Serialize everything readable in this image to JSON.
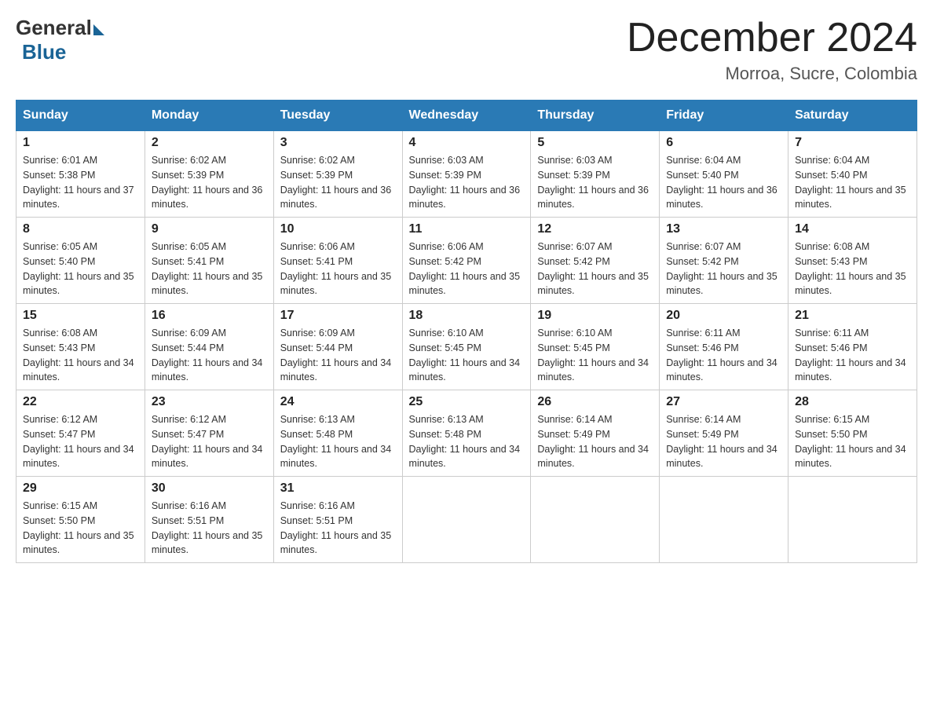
{
  "logo": {
    "general": "General",
    "blue": "Blue"
  },
  "header": {
    "month": "December 2024",
    "location": "Morroa, Sucre, Colombia"
  },
  "weekdays": [
    "Sunday",
    "Monday",
    "Tuesday",
    "Wednesday",
    "Thursday",
    "Friday",
    "Saturday"
  ],
  "weeks": [
    [
      {
        "day": "1",
        "sunrise": "6:01 AM",
        "sunset": "5:38 PM",
        "daylight": "11 hours and 37 minutes."
      },
      {
        "day": "2",
        "sunrise": "6:02 AM",
        "sunset": "5:39 PM",
        "daylight": "11 hours and 36 minutes."
      },
      {
        "day": "3",
        "sunrise": "6:02 AM",
        "sunset": "5:39 PM",
        "daylight": "11 hours and 36 minutes."
      },
      {
        "day": "4",
        "sunrise": "6:03 AM",
        "sunset": "5:39 PM",
        "daylight": "11 hours and 36 minutes."
      },
      {
        "day": "5",
        "sunrise": "6:03 AM",
        "sunset": "5:39 PM",
        "daylight": "11 hours and 36 minutes."
      },
      {
        "day": "6",
        "sunrise": "6:04 AM",
        "sunset": "5:40 PM",
        "daylight": "11 hours and 36 minutes."
      },
      {
        "day": "7",
        "sunrise": "6:04 AM",
        "sunset": "5:40 PM",
        "daylight": "11 hours and 35 minutes."
      }
    ],
    [
      {
        "day": "8",
        "sunrise": "6:05 AM",
        "sunset": "5:40 PM",
        "daylight": "11 hours and 35 minutes."
      },
      {
        "day": "9",
        "sunrise": "6:05 AM",
        "sunset": "5:41 PM",
        "daylight": "11 hours and 35 minutes."
      },
      {
        "day": "10",
        "sunrise": "6:06 AM",
        "sunset": "5:41 PM",
        "daylight": "11 hours and 35 minutes."
      },
      {
        "day": "11",
        "sunrise": "6:06 AM",
        "sunset": "5:42 PM",
        "daylight": "11 hours and 35 minutes."
      },
      {
        "day": "12",
        "sunrise": "6:07 AM",
        "sunset": "5:42 PM",
        "daylight": "11 hours and 35 minutes."
      },
      {
        "day": "13",
        "sunrise": "6:07 AM",
        "sunset": "5:42 PM",
        "daylight": "11 hours and 35 minutes."
      },
      {
        "day": "14",
        "sunrise": "6:08 AM",
        "sunset": "5:43 PM",
        "daylight": "11 hours and 35 minutes."
      }
    ],
    [
      {
        "day": "15",
        "sunrise": "6:08 AM",
        "sunset": "5:43 PM",
        "daylight": "11 hours and 34 minutes."
      },
      {
        "day": "16",
        "sunrise": "6:09 AM",
        "sunset": "5:44 PM",
        "daylight": "11 hours and 34 minutes."
      },
      {
        "day": "17",
        "sunrise": "6:09 AM",
        "sunset": "5:44 PM",
        "daylight": "11 hours and 34 minutes."
      },
      {
        "day": "18",
        "sunrise": "6:10 AM",
        "sunset": "5:45 PM",
        "daylight": "11 hours and 34 minutes."
      },
      {
        "day": "19",
        "sunrise": "6:10 AM",
        "sunset": "5:45 PM",
        "daylight": "11 hours and 34 minutes."
      },
      {
        "day": "20",
        "sunrise": "6:11 AM",
        "sunset": "5:46 PM",
        "daylight": "11 hours and 34 minutes."
      },
      {
        "day": "21",
        "sunrise": "6:11 AM",
        "sunset": "5:46 PM",
        "daylight": "11 hours and 34 minutes."
      }
    ],
    [
      {
        "day": "22",
        "sunrise": "6:12 AM",
        "sunset": "5:47 PM",
        "daylight": "11 hours and 34 minutes."
      },
      {
        "day": "23",
        "sunrise": "6:12 AM",
        "sunset": "5:47 PM",
        "daylight": "11 hours and 34 minutes."
      },
      {
        "day": "24",
        "sunrise": "6:13 AM",
        "sunset": "5:48 PM",
        "daylight": "11 hours and 34 minutes."
      },
      {
        "day": "25",
        "sunrise": "6:13 AM",
        "sunset": "5:48 PM",
        "daylight": "11 hours and 34 minutes."
      },
      {
        "day": "26",
        "sunrise": "6:14 AM",
        "sunset": "5:49 PM",
        "daylight": "11 hours and 34 minutes."
      },
      {
        "day": "27",
        "sunrise": "6:14 AM",
        "sunset": "5:49 PM",
        "daylight": "11 hours and 34 minutes."
      },
      {
        "day": "28",
        "sunrise": "6:15 AM",
        "sunset": "5:50 PM",
        "daylight": "11 hours and 34 minutes."
      }
    ],
    [
      {
        "day": "29",
        "sunrise": "6:15 AM",
        "sunset": "5:50 PM",
        "daylight": "11 hours and 35 minutes."
      },
      {
        "day": "30",
        "sunrise": "6:16 AM",
        "sunset": "5:51 PM",
        "daylight": "11 hours and 35 minutes."
      },
      {
        "day": "31",
        "sunrise": "6:16 AM",
        "sunset": "5:51 PM",
        "daylight": "11 hours and 35 minutes."
      },
      null,
      null,
      null,
      null
    ]
  ]
}
